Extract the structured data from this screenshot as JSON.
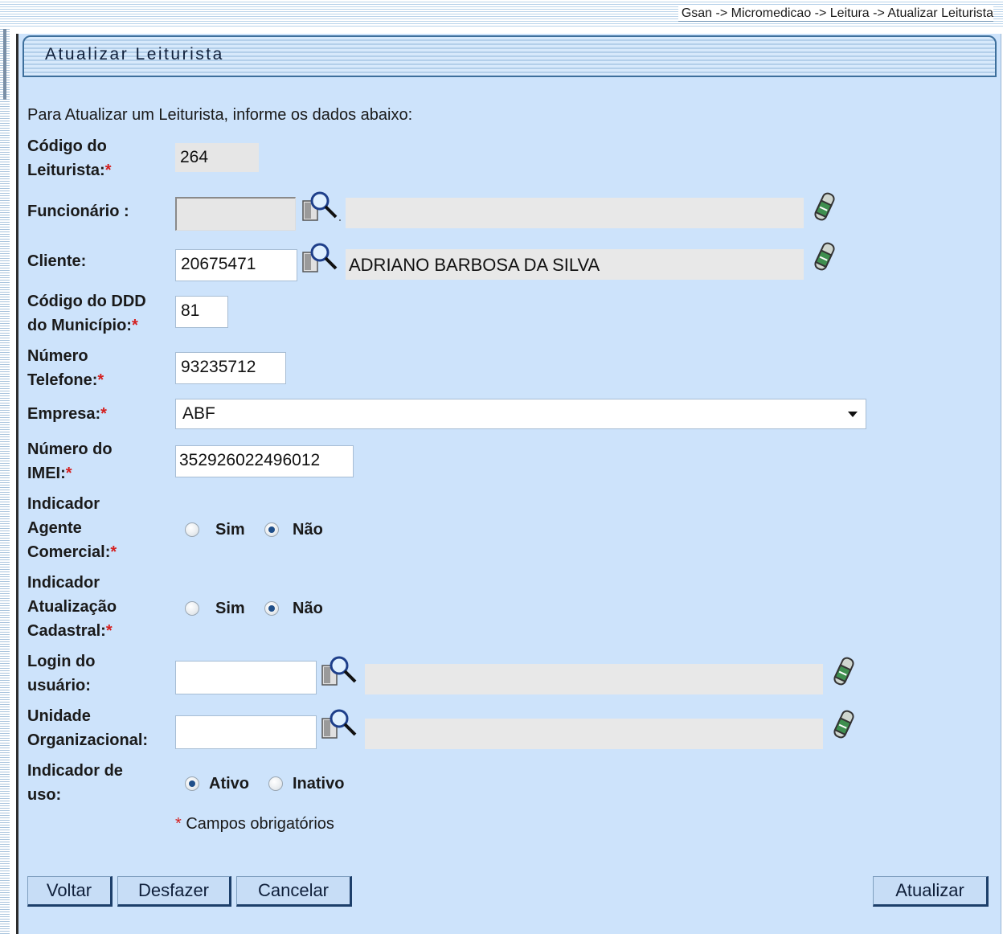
{
  "breadcrumb": "Gsan -> Micromedicao -> Leitura -> Atualizar Leiturista",
  "page_title": "Atualizar Leiturista",
  "intro_text": "Para Atualizar um Leiturista, informe os dados abaixo:",
  "required_mark": "*",
  "colors": {
    "panel_bg": "#cde3fb",
    "title_border": "#3d6f9c",
    "required": "#d42020"
  },
  "fields": {
    "codigo": {
      "label_line1": "Código do",
      "label_line2": "Leiturista:",
      "value": "264"
    },
    "funcionario": {
      "label": "Funcionário :",
      "value": "",
      "name": ""
    },
    "cliente": {
      "label": "Cliente:",
      "value": "20675471",
      "name": "ADRIANO BARBOSA DA SILVA"
    },
    "ddd": {
      "label_line1": "Código do DDD",
      "label_line2": "do Município:",
      "value": "81"
    },
    "telefone": {
      "label_line1": "Número",
      "label_line2": "Telefone:",
      "value": "93235712"
    },
    "empresa": {
      "label": "Empresa:",
      "selected": "ABF"
    },
    "imei": {
      "label_line1": "Número do",
      "label_line2": "IMEI:",
      "value": "352926022496012"
    },
    "agente_comercial": {
      "label_line1": "Indicador",
      "label_line2": "Agente",
      "label_line3": "Comercial:",
      "option_yes": "Sim",
      "option_no": "Não",
      "selected": "Não"
    },
    "atualizacao_cadastral": {
      "label_line1": "Indicador",
      "label_line2": "Atualização",
      "label_line3": "Cadastral:",
      "option_yes": "Sim",
      "option_no": "Não",
      "selected": "Não"
    },
    "login": {
      "label_line1": "Login do",
      "label_line2": "usuário:",
      "value": "",
      "name": ""
    },
    "unidade": {
      "label_line1": "Unidade",
      "label_line2": "Organizacional:",
      "value": "",
      "name": ""
    },
    "uso": {
      "label_line1": "Indicador de",
      "label_line2": "uso:",
      "option_active": "Ativo",
      "option_inactive": "Inativo",
      "selected": "Ativo"
    }
  },
  "required_note": "Campos obrigatórios",
  "buttons": {
    "voltar": "Voltar",
    "desfazer": "Desfazer",
    "cancelar": "Cancelar",
    "atualizar": "Atualizar"
  },
  "icons": {
    "lookup": "search-icon",
    "clear": "eraser-icon"
  }
}
